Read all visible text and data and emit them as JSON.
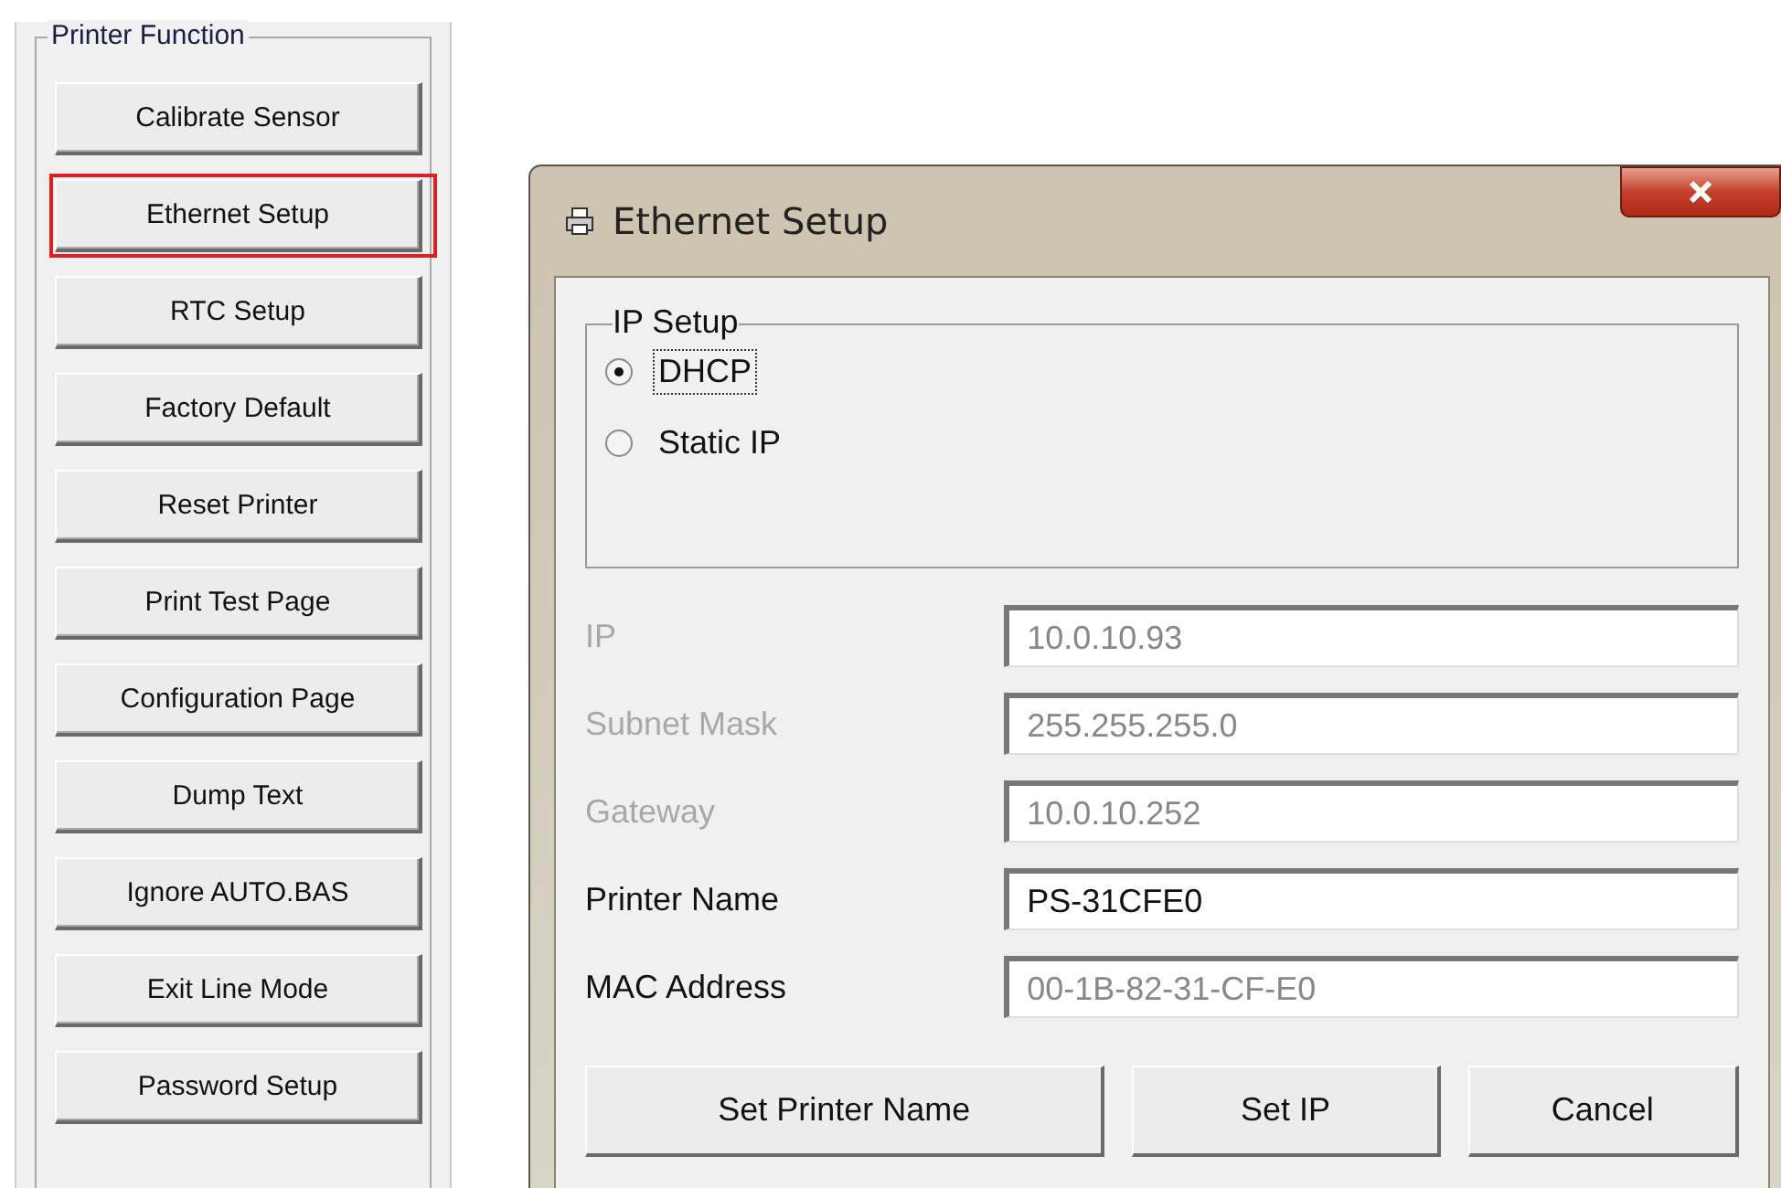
{
  "printer_function": {
    "title": "Printer Function",
    "buttons": [
      {
        "label": "Calibrate Sensor",
        "highlighted": false
      },
      {
        "label": "Ethernet Setup",
        "highlighted": true
      },
      {
        "label": "RTC Setup",
        "highlighted": false
      },
      {
        "label": "Factory Default",
        "highlighted": false
      },
      {
        "label": "Reset Printer",
        "highlighted": false
      },
      {
        "label": "Print Test Page",
        "highlighted": false
      },
      {
        "label": "Configuration Page",
        "highlighted": false
      },
      {
        "label": "Dump Text",
        "highlighted": false
      },
      {
        "label": "Ignore AUTO.BAS",
        "highlighted": false
      },
      {
        "label": "Exit Line Mode",
        "highlighted": false
      },
      {
        "label": "Password Setup",
        "highlighted": false
      }
    ]
  },
  "dialog": {
    "title": "Ethernet Setup",
    "ip_setup": {
      "title": "IP Setup",
      "options": [
        {
          "label": "DHCP",
          "selected": true,
          "focused": true
        },
        {
          "label": "Static IP",
          "selected": false,
          "focused": false
        }
      ]
    },
    "fields": [
      {
        "label": "IP",
        "value": "10.0.10.93",
        "disabled": true,
        "readonly": true
      },
      {
        "label": "Subnet Mask",
        "value": "255.255.255.0",
        "disabled": true,
        "readonly": true
      },
      {
        "label": "Gateway",
        "value": "10.0.10.252",
        "disabled": true,
        "readonly": true
      },
      {
        "label": "Printer Name",
        "value": "PS-31CFE0",
        "disabled": false,
        "readonly": false
      },
      {
        "label": "MAC Address",
        "value": "00-1B-82-31-CF-E0",
        "disabled": false,
        "readonly": true
      }
    ],
    "buttons": [
      "Set Printer Name",
      "Set IP",
      "Cancel"
    ]
  }
}
